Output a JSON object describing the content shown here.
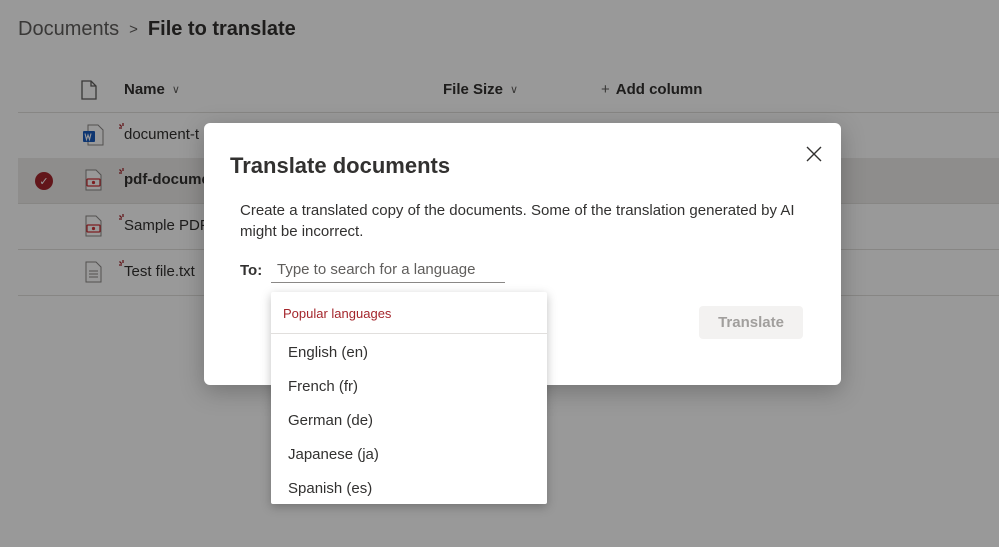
{
  "breadcrumb": {
    "root": "Documents",
    "separator": ">",
    "current": "File to translate"
  },
  "list": {
    "columns": {
      "name": "Name",
      "size": "File Size",
      "add": "Add column"
    },
    "rows": [
      {
        "name": "document-t",
        "icon": "word-file-icon",
        "selected": false
      },
      {
        "name": "pdf-docume",
        "icon": "pdf-file-icon",
        "selected": true
      },
      {
        "name": "Sample PDF",
        "icon": "pdf-file-icon",
        "selected": false
      },
      {
        "name": "Test file.txt",
        "icon": "text-file-icon",
        "selected": false
      }
    ]
  },
  "dialog": {
    "title": "Translate documents",
    "description": "Create a translated copy of the documents. Some of the translation generated by AI might be incorrect.",
    "to_label": "To:",
    "search_placeholder": "Type to search for a language",
    "translate_label": "Translate"
  },
  "dropdown": {
    "header": "Popular languages",
    "items": [
      "English (en)",
      "French (fr)",
      "German (de)",
      "Japanese (ja)",
      "Spanish (es)"
    ]
  },
  "colors": {
    "accent": "#a4262c",
    "overlay": "rgba(0,0,0,0.40)"
  }
}
